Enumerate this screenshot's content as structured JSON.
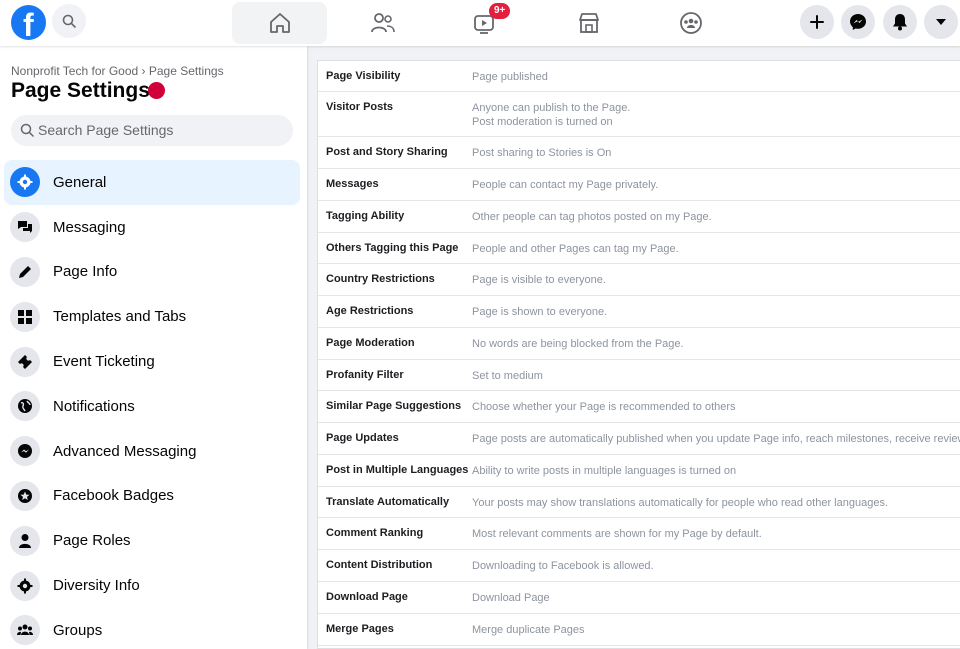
{
  "top_bar": {
    "notification_badge": "9+"
  },
  "sidebar": {
    "breadcrumb": "Nonprofit Tech for Good › Page Settings",
    "title": "Page Settings",
    "search_placeholder": "Search Page Settings",
    "items": [
      {
        "label": "General",
        "icon": "gear-icon",
        "active": true
      },
      {
        "label": "Messaging",
        "icon": "chat-bubbles-icon"
      },
      {
        "label": "Page Info",
        "icon": "pencil-icon"
      },
      {
        "label": "Templates and Tabs",
        "icon": "grid-icon"
      },
      {
        "label": "Event Ticketing",
        "icon": "ticket-icon"
      },
      {
        "label": "Notifications",
        "icon": "globe-icon"
      },
      {
        "label": "Advanced Messaging",
        "icon": "messenger-icon"
      },
      {
        "label": "Facebook Badges",
        "icon": "star-badge-icon"
      },
      {
        "label": "Page Roles",
        "icon": "person-icon"
      },
      {
        "label": "Diversity Info",
        "icon": "gear-icon"
      },
      {
        "label": "Groups",
        "icon": "group-icon"
      }
    ]
  },
  "settings": [
    {
      "label": "Page Visibility",
      "value": "Page published"
    },
    {
      "label": "Visitor Posts",
      "value": "Anyone can publish to the Page.",
      "value2": "Post moderation is turned on"
    },
    {
      "label": "Post and Story Sharing",
      "value": "Post sharing to Stories is On"
    },
    {
      "label": "Messages",
      "value": "People can contact my Page privately."
    },
    {
      "label": "Tagging Ability",
      "value": "Other people can tag photos posted on my Page."
    },
    {
      "label": "Others Tagging this Page",
      "value": "People and other Pages can tag my Page."
    },
    {
      "label": "Country Restrictions",
      "value": "Page is visible to everyone."
    },
    {
      "label": "Age Restrictions",
      "value": "Page is shown to everyone."
    },
    {
      "label": "Page Moderation",
      "value": "No words are being blocked from the Page."
    },
    {
      "label": "Profanity Filter",
      "value": "Set to medium"
    },
    {
      "label": "Similar Page Suggestions",
      "value": "Choose whether your Page is recommended to others"
    },
    {
      "label": "Page Updates",
      "value": "Page posts are automatically published when you update Page info, reach milestones, receive reviews and"
    },
    {
      "label": "Post in Multiple Languages",
      "value": "Ability to write posts in multiple languages is turned on"
    },
    {
      "label": "Translate Automatically",
      "value": "Your posts may show translations automatically for people who read other languages."
    },
    {
      "label": "Comment Ranking",
      "value": "Most relevant comments are shown for my Page by default."
    },
    {
      "label": "Content Distribution",
      "value": "Downloading to Facebook is allowed."
    },
    {
      "label": "Download Page",
      "value": "Download Page"
    },
    {
      "label": "Merge Pages",
      "value": "Merge duplicate Pages"
    }
  ]
}
